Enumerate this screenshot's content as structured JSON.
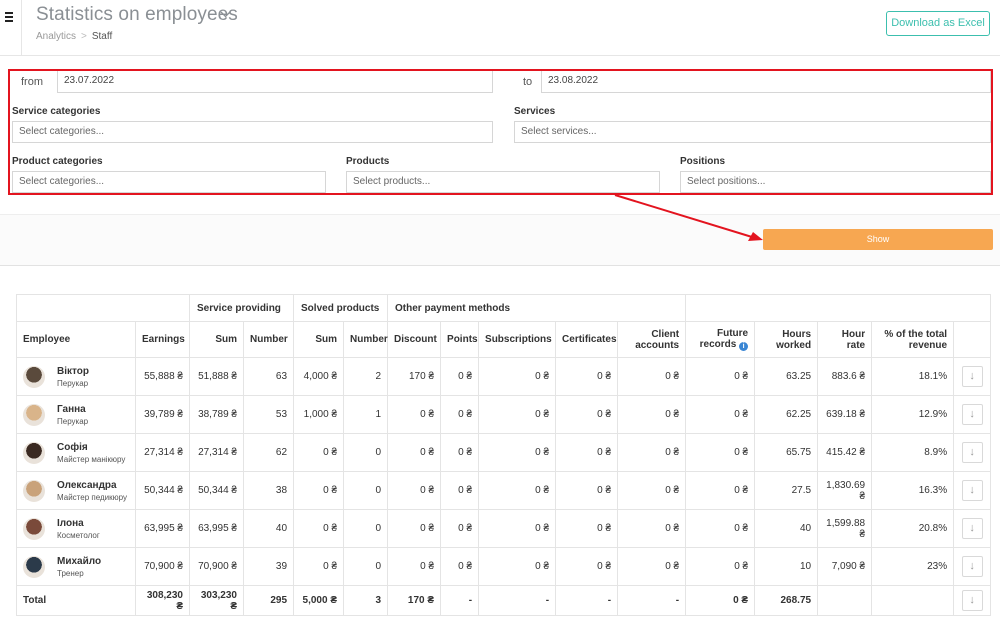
{
  "header": {
    "title": "Statistics on employees",
    "breadcrumb": [
      "Analytics",
      "Staff"
    ],
    "breadcrumb_sep": ">",
    "download_label": "Download as Excel"
  },
  "filters": {
    "from_label": "from",
    "from_value": "23.07.2022",
    "to_label": "to",
    "to_value": "23.08.2022",
    "service_categories_label": "Service categories",
    "service_categories_placeholder": "Select categories...",
    "services_label": "Services",
    "services_placeholder": "Select services...",
    "product_categories_label": "Product categories",
    "product_categories_placeholder": "Select categories...",
    "products_label": "Products",
    "products_placeholder": "Select products...",
    "positions_label": "Positions",
    "positions_placeholder": "Select positions...",
    "show_label": "Show"
  },
  "colors": {
    "accent_teal": "#3cbfae",
    "show_orange": "#f7a751",
    "highlight_red": "#e3141f"
  },
  "table": {
    "groups": {
      "service": "Service providing",
      "solved": "Solved products",
      "other": "Other payment methods"
    },
    "columns": {
      "employee": "Employee",
      "earnings": "Earnings",
      "sum": "Sum",
      "number": "Number",
      "sum2": "Sum",
      "number2": "Number",
      "discount": "Discount",
      "points": "Points",
      "subscriptions": "Subscriptions",
      "certificates": "Certificates",
      "client_accounts": "Client accounts",
      "future_records": "Future records",
      "hours_worked": "Hours worked",
      "hour_rate": "Hour rate",
      "pct_revenue": "% of the total revenue"
    },
    "rows": [
      {
        "name": "Віктор",
        "position": "Перукар",
        "earnings": "55,888 ₴",
        "svc_sum": "51,888 ₴",
        "svc_num": "63",
        "prod_sum": "4,000 ₴",
        "prod_num": "2",
        "discount": "170 ₴",
        "points": "0 ₴",
        "subscriptions": "0 ₴",
        "certificates": "0 ₴",
        "client_accounts": "0 ₴",
        "future": "0 ₴",
        "hours": "63.25",
        "rate": "883.6 ₴",
        "pct": "18.1%"
      },
      {
        "name": "Ганна",
        "position": "Перукар",
        "earnings": "39,789 ₴",
        "svc_sum": "38,789 ₴",
        "svc_num": "53",
        "prod_sum": "1,000 ₴",
        "prod_num": "1",
        "discount": "0 ₴",
        "points": "0 ₴",
        "subscriptions": "0 ₴",
        "certificates": "0 ₴",
        "client_accounts": "0 ₴",
        "future": "0 ₴",
        "hours": "62.25",
        "rate": "639.18 ₴",
        "pct": "12.9%"
      },
      {
        "name": "Софія",
        "position": "Майстер манікюру",
        "earnings": "27,314 ₴",
        "svc_sum": "27,314 ₴",
        "svc_num": "62",
        "prod_sum": "0 ₴",
        "prod_num": "0",
        "discount": "0 ₴",
        "points": "0 ₴",
        "subscriptions": "0 ₴",
        "certificates": "0 ₴",
        "client_accounts": "0 ₴",
        "future": "0 ₴",
        "hours": "65.75",
        "rate": "415.42 ₴",
        "pct": "8.9%"
      },
      {
        "name": "Олександра",
        "position": "Майстер педикюру",
        "earnings": "50,344 ₴",
        "svc_sum": "50,344 ₴",
        "svc_num": "38",
        "prod_sum": "0 ₴",
        "prod_num": "0",
        "discount": "0 ₴",
        "points": "0 ₴",
        "subscriptions": "0 ₴",
        "certificates": "0 ₴",
        "client_accounts": "0 ₴",
        "future": "0 ₴",
        "hours": "27.5",
        "rate": "1,830.69 ₴",
        "pct": "16.3%"
      },
      {
        "name": "Ілона",
        "position": "Косметолог",
        "earnings": "63,995 ₴",
        "svc_sum": "63,995 ₴",
        "svc_num": "40",
        "prod_sum": "0 ₴",
        "prod_num": "0",
        "discount": "0 ₴",
        "points": "0 ₴",
        "subscriptions": "0 ₴",
        "certificates": "0 ₴",
        "client_accounts": "0 ₴",
        "future": "0 ₴",
        "hours": "40",
        "rate": "1,599.88 ₴",
        "pct": "20.8%"
      },
      {
        "name": "Михайло",
        "position": "Тренер",
        "earnings": "70,900 ₴",
        "svc_sum": "70,900 ₴",
        "svc_num": "39",
        "prod_sum": "0 ₴",
        "prod_num": "0",
        "discount": "0 ₴",
        "points": "0 ₴",
        "subscriptions": "0 ₴",
        "certificates": "0 ₴",
        "client_accounts": "0 ₴",
        "future": "0 ₴",
        "hours": "10",
        "rate": "7,090 ₴",
        "pct": "23%"
      }
    ],
    "total": {
      "label": "Total",
      "earnings": "308,230 ₴",
      "svc_sum": "303,230 ₴",
      "svc_num": "295",
      "prod_sum": "5,000 ₴",
      "prod_num": "3",
      "discount": "170 ₴",
      "points": "-",
      "subscriptions": "-",
      "certificates": "-",
      "client_accounts": "-",
      "future": "0 ₴",
      "hours": "268.75"
    }
  }
}
